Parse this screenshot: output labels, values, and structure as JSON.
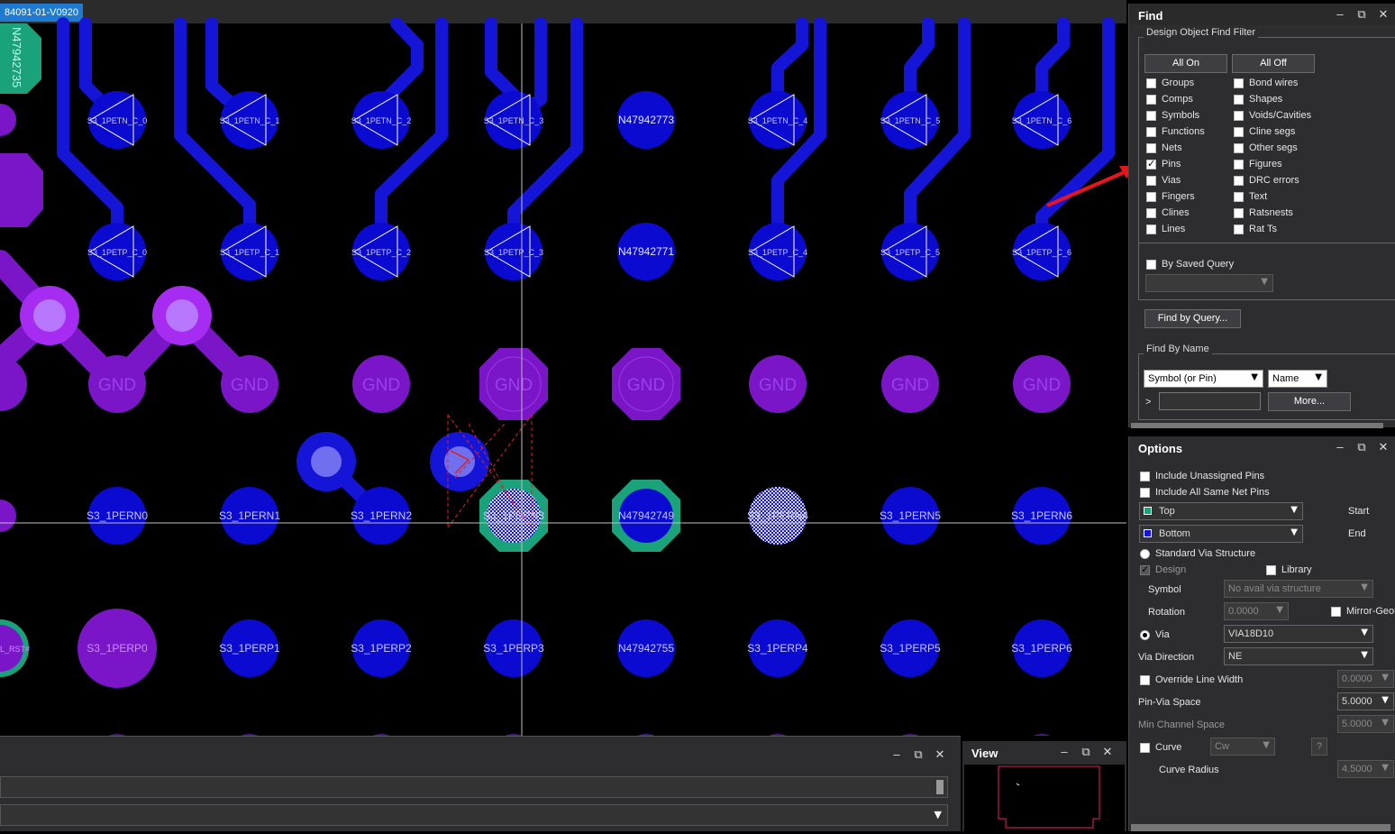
{
  "document_tab": "84091-01-V0920",
  "canvas": {
    "row1_labels": [
      "S3_1PETN_C_0",
      "S3_1PETN_C_1",
      "S3_1PETN_C_2",
      "S3_1PETN_C_3",
      "N47942773",
      "S3_1PETN_C_4",
      "S3_1PETN_C_5",
      "S3_1PETN_C_6"
    ],
    "row2_labels": [
      "S3_1PETP_C_0",
      "S3_1PETP_C_1",
      "S3_1PETP_C_2",
      "S3_1PETP_C_3",
      "N47942771",
      "S3_1PETP_C_4",
      "S3_1PETP_C_5",
      "S3_1PETP_C_6"
    ],
    "row3_label": "GND",
    "row4_labels": [
      "S3_1PERN0",
      "S3_1PERN1",
      "S3_1PERN2",
      "S3_1PERN3",
      "N47942749",
      "S3_1PERN4",
      "S3_1PERN5",
      "S3_1PERN6"
    ],
    "row5_labels": [
      "S3_1PERP0",
      "S3_1PERP1",
      "S3_1PERP2",
      "S3_1PERP3",
      "N47942755",
      "S3_1PERP4",
      "S3_1PERP5",
      "S3_1PERP6"
    ],
    "left_edge_label": "N47942735",
    "left_edge_label2": "L_RST#",
    "colors": {
      "blue_pad": "#0a0ad0",
      "blue_trace": "#1515d8",
      "gnd_pad": "#7a16c8",
      "gnd_bright": "#a52cf0",
      "green_pad": "#1aa37a",
      "cursor": "#bfbfbf"
    }
  },
  "find_panel": {
    "title": "Find",
    "filter_group": "Design Object Find Filter",
    "all_on": "All On",
    "all_off": "All Off",
    "left_items": [
      {
        "label": "Groups",
        "checked": false
      },
      {
        "label": "Comps",
        "checked": false
      },
      {
        "label": "Symbols",
        "checked": false
      },
      {
        "label": "Functions",
        "checked": false
      },
      {
        "label": "Nets",
        "checked": false
      },
      {
        "label": "Pins",
        "checked": true
      },
      {
        "label": "Vias",
        "checked": false
      },
      {
        "label": "Fingers",
        "checked": false
      },
      {
        "label": "Clines",
        "checked": false
      },
      {
        "label": "Lines",
        "checked": false
      }
    ],
    "right_items": [
      {
        "label": "Bond wires",
        "checked": false
      },
      {
        "label": "Shapes",
        "checked": false
      },
      {
        "label": "Voids/Cavities",
        "checked": false
      },
      {
        "label": "Cline segs",
        "checked": false
      },
      {
        "label": "Other segs",
        "checked": false
      },
      {
        "label": "Figures",
        "checked": false
      },
      {
        "label": "DRC errors",
        "checked": false
      },
      {
        "label": "Text",
        "checked": false
      },
      {
        "label": "Ratsnests",
        "checked": false
      },
      {
        "label": "Rat Ts",
        "checked": false
      }
    ],
    "by_saved_query": "By Saved Query",
    "find_by_query": "Find by Query...",
    "find_by_name_group": "Find By Name",
    "name_type": "Symbol (or Pin)",
    "name_mode": "Name",
    "name_prefix": ">",
    "name_value": "",
    "more_button": "More..."
  },
  "options_panel": {
    "title": "Options",
    "include_unassigned": "Include Unassigned Pins",
    "include_same_net": "Include All Same Net Pins",
    "start_layer": "Top",
    "start_label": "Start",
    "start_color": "#1aa37a",
    "end_layer": "Bottom",
    "end_label": "End",
    "end_color": "#1515d8",
    "standard_via": "Standard Via Structure",
    "design": "Design",
    "library": "Library",
    "symbol_label": "Symbol",
    "symbol_value": "No avail via structure",
    "rotation_label": "Rotation",
    "rotation_value": "0.0000",
    "mirror_label": "Mirror-Geometry",
    "via_label": "Via",
    "via_value": "VIA18D10",
    "via_direction_label": "Via Direction",
    "via_direction_value": "NE",
    "override_line_width": "Override Line Width",
    "override_value": "0.0000",
    "pin_via_space_label": "Pin-Via Space",
    "pin_via_space_value": "5.0000",
    "min_channel_label": "Min Channel Space",
    "min_channel_value": "5.0000",
    "curve_label": "Curve",
    "curve_value": "Cw",
    "curve_help": "?",
    "curve_radius_label": "Curve Radius",
    "curve_radius_value": "4.5000"
  },
  "view_panel": {
    "title": "View"
  }
}
